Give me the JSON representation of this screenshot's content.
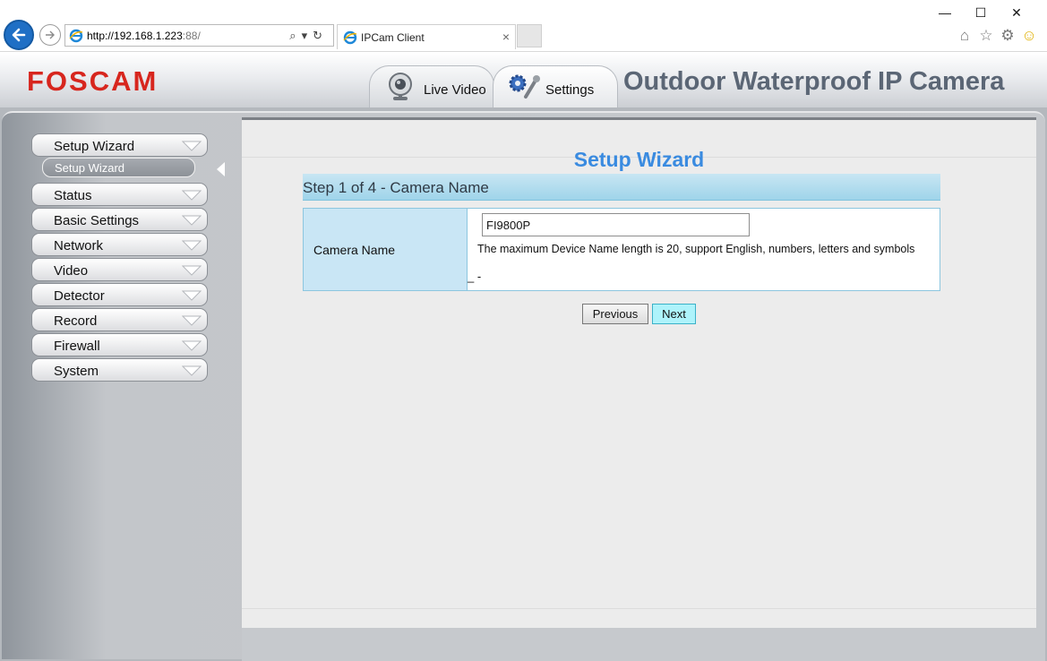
{
  "browser": {
    "url_host": "http://192.168.1.223",
    "url_rest": ":88/",
    "tab_title": "IPCam Client",
    "tab_close": "×",
    "window_controls": [
      "—",
      "☐",
      "✕"
    ],
    "tool_icons": [
      "home-icon",
      "star-icon",
      "gear-icon",
      "smiley-icon"
    ]
  },
  "header": {
    "logo": "FOSCAM",
    "product_title": "Outdoor Waterproof IP Camera",
    "tabs": [
      {
        "label": "Live Video",
        "icon": "webcam-icon"
      },
      {
        "label": "Settings",
        "icon": "settings-gears-icon"
      }
    ]
  },
  "sidebar": {
    "items": [
      {
        "label": "Setup Wizard",
        "expanded": true,
        "children": [
          {
            "label": "Setup Wizard",
            "selected": true
          }
        ]
      },
      {
        "label": "Status"
      },
      {
        "label": "Basic Settings"
      },
      {
        "label": "Network"
      },
      {
        "label": "Video"
      },
      {
        "label": "Detector"
      },
      {
        "label": "Record"
      },
      {
        "label": "Firewall"
      },
      {
        "label": "System"
      }
    ]
  },
  "main": {
    "title": "Setup Wizard",
    "step_label": "Step 1 of 4 - Camera Name",
    "form": {
      "field_label": "Camera Name",
      "field_value": "FI9800P",
      "hint": "The maximum Device Name length is 20, support English, numbers, letters and symbols",
      "underscore": "_ -"
    },
    "buttons": {
      "previous": "Previous",
      "next": "Next"
    }
  },
  "colors": {
    "accent_blue": "#3a8be0",
    "logo_red": "#d7261e",
    "step_bar": "#9fd4ea",
    "next_button": "#aef3fb"
  }
}
